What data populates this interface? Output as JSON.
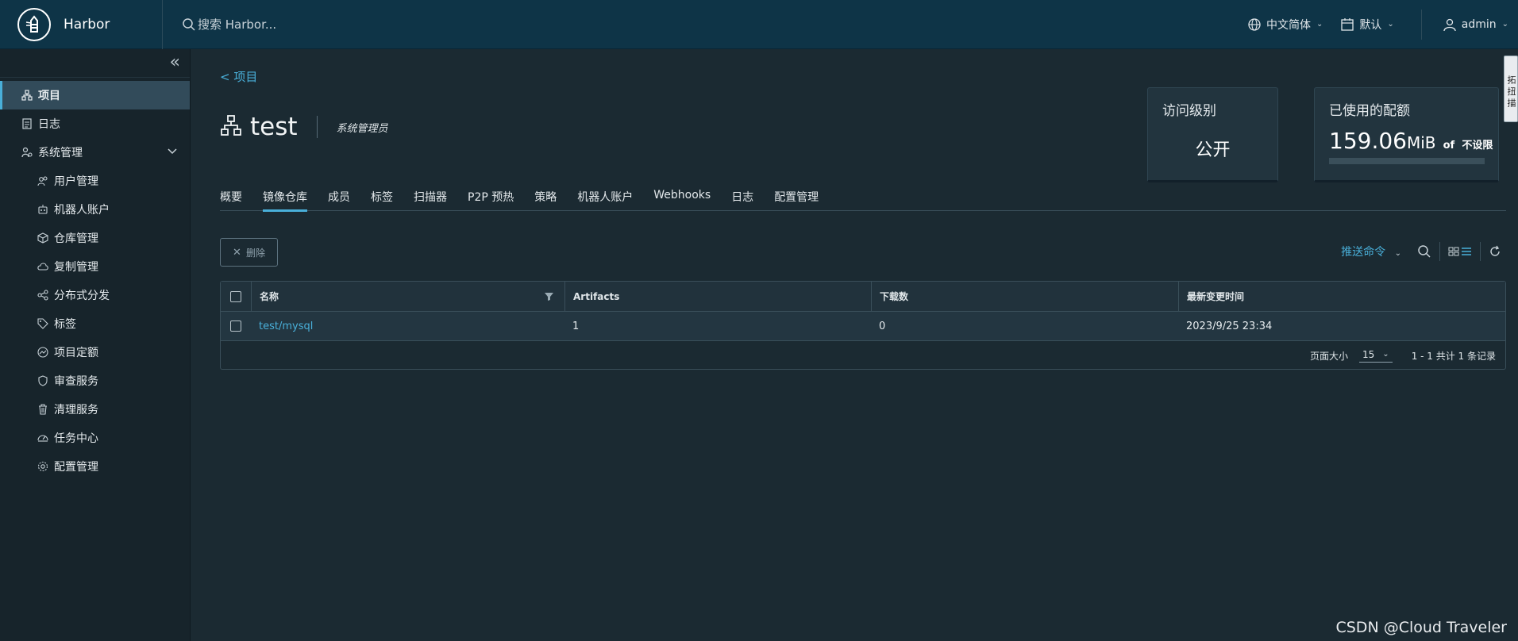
{
  "header": {
    "brand": "Harbor",
    "search_placeholder": "搜索 Harbor...",
    "language": "中文简体",
    "date_format": "默认",
    "user": "admin"
  },
  "sidebar": {
    "items": [
      {
        "label": "项目",
        "icon": "project-icon",
        "active": true
      },
      {
        "label": "日志",
        "icon": "log-icon"
      },
      {
        "label": "系统管理",
        "icon": "admin-icon",
        "expanded": true
      }
    ],
    "sub_items": [
      {
        "label": "用户管理",
        "icon": "users-icon"
      },
      {
        "label": "机器人账户",
        "icon": "robot-icon"
      },
      {
        "label": "仓库管理",
        "icon": "registry-icon"
      },
      {
        "label": "复制管理",
        "icon": "cloud-replication-icon"
      },
      {
        "label": "分布式分发",
        "icon": "share-icon"
      },
      {
        "label": "标签",
        "icon": "tag-icon"
      },
      {
        "label": "项目定额",
        "icon": "quota-icon"
      },
      {
        "label": "审查服务",
        "icon": "shield-icon"
      },
      {
        "label": "清理服务",
        "icon": "trash-icon"
      },
      {
        "label": "任务中心",
        "icon": "dashboard-icon"
      },
      {
        "label": "配置管理",
        "icon": "gear-icon"
      }
    ]
  },
  "main": {
    "back_link": "< 项目",
    "project_name": "test",
    "role": "系统管理员",
    "access_card": {
      "title": "访问级别",
      "value": "公开"
    },
    "quota_card": {
      "title": "已使用的配额",
      "value": "159.06",
      "unit": "MiB",
      "of": "of",
      "limit": "不设限",
      "used_fraction": 0
    },
    "tabs": [
      "概要",
      "镜像仓库",
      "成员",
      "标签",
      "扫描器",
      "P2P 预热",
      "策略",
      "机器人账户",
      "Webhooks",
      "日志",
      "配置管理"
    ],
    "active_tab": "镜像仓库",
    "delete_button": "删除",
    "push_command": "推送命令",
    "table": {
      "columns": [
        "名称",
        "Artifacts",
        "下载数",
        "最新变更时间"
      ],
      "rows": [
        {
          "name": "test/mysql",
          "artifacts": "1",
          "downloads": "0",
          "updated": "2023/9/25 23:34"
        }
      ],
      "page_size_label": "页面大小",
      "page_size": "15",
      "summary": "1 - 1 共计 1 条记录"
    }
  },
  "watermark": "CSDN @Cloud Traveler",
  "side_tab": "拓 扭 描"
}
